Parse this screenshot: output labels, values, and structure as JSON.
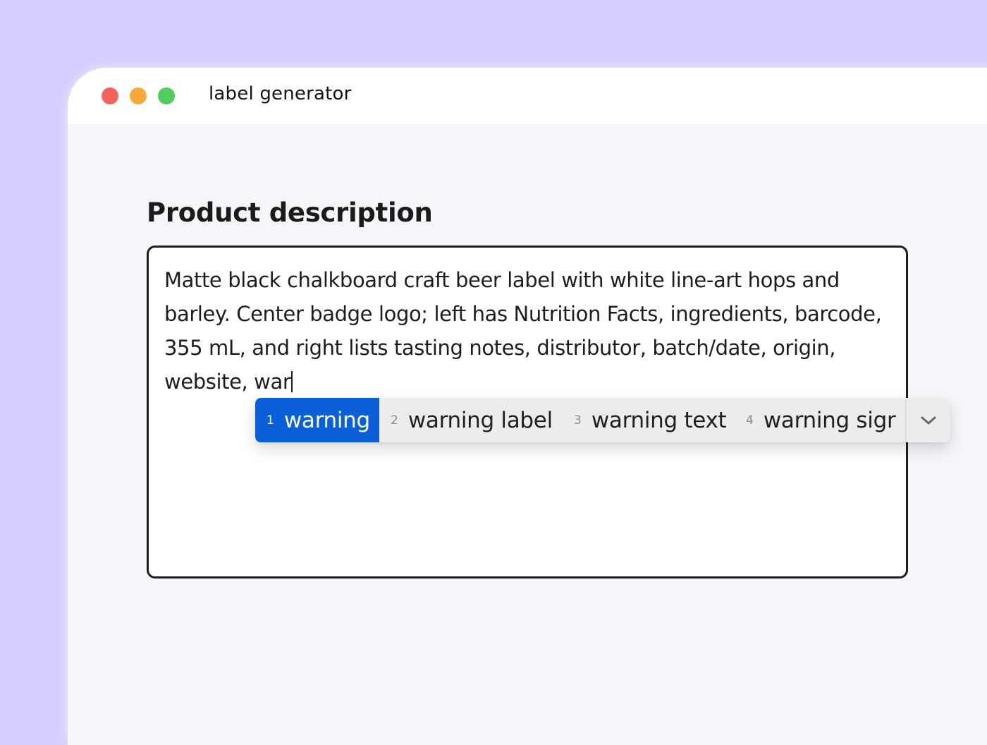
{
  "window": {
    "title": "label generator",
    "controls": [
      "close",
      "minimize",
      "maximize"
    ]
  },
  "form": {
    "heading": "Product description",
    "description_value": "Matte black chalkboard craft beer label with white line-art hops and barley. Center badge logo; left has Nutrition Facts, ingredients, barcode, 355 mL, and right lists tasting notes, distributor, batch/date, origin, website, war"
  },
  "autocomplete": {
    "suggestions": [
      {
        "num": "1",
        "text": "warning",
        "selected": true
      },
      {
        "num": "2",
        "text": "warning label",
        "selected": false
      },
      {
        "num": "3",
        "text": "warning text",
        "selected": false
      },
      {
        "num": "4",
        "text": "warning sigr",
        "selected": false
      }
    ],
    "expand_icon": "chevron-down-icon"
  },
  "colors": {
    "background": "#d5cdfb",
    "selected_suggestion": "#0b5fd9",
    "close": "#f2635c",
    "minimize": "#f7a93b",
    "maximize": "#4fce5c"
  }
}
